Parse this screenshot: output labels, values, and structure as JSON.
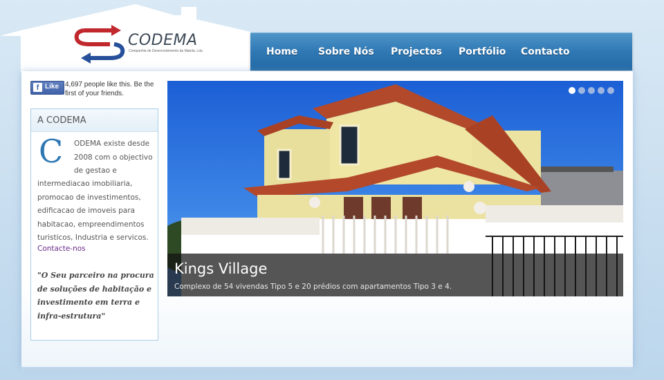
{
  "logo": {
    "name": "CODEMA",
    "tagline": "Companhia de Desenvolvimento da Matola, Lda"
  },
  "nav": {
    "items": [
      {
        "label": "Home"
      },
      {
        "label": "Sobre Nós"
      },
      {
        "label": "Projectos"
      },
      {
        "label": "Portfólio"
      },
      {
        "label": "Contacto"
      }
    ]
  },
  "facebook": {
    "like_label": "Like",
    "text": "4,697 people like this. Be the first of your friends."
  },
  "sidebar": {
    "title": "A CODEMA",
    "dropcap": "C",
    "about_first": "ODEMA existe desde 2008 com o objectivo de gestao e",
    "about_rest": "intermediacao imobiliaria, promocao de investimentos, edificacao de imoveis para habitacao, empreendimentos turisticos,  Industria e servicos.",
    "contact_link": "Contacte-nos",
    "quote": "\"O Seu parceiro na procura de soluções de habitação e investimento em terra e infra-estrutura\""
  },
  "slider": {
    "title": "Kings Village",
    "description": "Complexo de 54 vivendas Tipo 5 e 20 prédios com apartamentos Tipo 3 e 4.",
    "dots_total": 5,
    "active_dot": 1
  },
  "colors": {
    "nav": "#2f78b4",
    "logo_red": "#c0282d",
    "logo_blue": "#27509b",
    "accent": "#2f78b4"
  }
}
